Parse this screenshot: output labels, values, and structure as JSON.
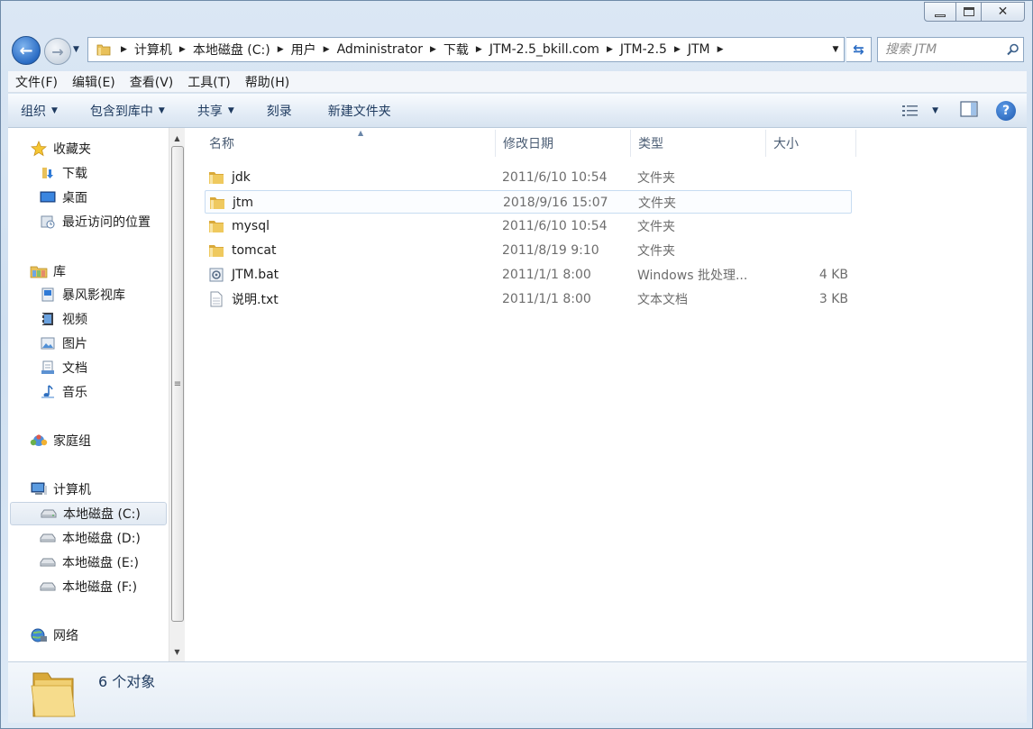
{
  "window": {
    "title": "JTM"
  },
  "caption_buttons": {
    "close_glyph": "✕"
  },
  "nav": {
    "back_glyph": "←",
    "forward_glyph": "→",
    "refresh_glyph": "⇆"
  },
  "breadcrumb": [
    "计算机",
    "本地磁盘 (C:)",
    "用户",
    "Administrator",
    "下载",
    "JTM-2.5_bkill.com",
    "JTM-2.5",
    "JTM"
  ],
  "search": {
    "placeholder": "搜索 JTM"
  },
  "menubar": {
    "file": "文件(F)",
    "edit": "编辑(E)",
    "view": "查看(V)",
    "tools": "工具(T)",
    "help": "帮助(H)"
  },
  "toolbar": {
    "organize": "组织",
    "include_library": "包含到库中",
    "share": "共享",
    "burn": "刻录",
    "new_folder": "新建文件夹",
    "help_glyph": "?"
  },
  "sidebar": {
    "favorites": {
      "label": "收藏夹",
      "items": [
        "下载",
        "桌面",
        "最近访问的位置"
      ]
    },
    "libraries": {
      "label": "库",
      "items": [
        "暴风影视库",
        "视频",
        "图片",
        "文档",
        "音乐"
      ]
    },
    "homegroup": {
      "label": "家庭组"
    },
    "computer": {
      "label": "计算机",
      "items": [
        "本地磁盘 (C:)",
        "本地磁盘 (D:)",
        "本地磁盘 (E:)",
        "本地磁盘 (F:)"
      ]
    },
    "network": {
      "label": "网络"
    }
  },
  "columns": {
    "name": "名称",
    "modified": "修改日期",
    "type": "类型",
    "size": "大小"
  },
  "files": [
    {
      "name": "jdk",
      "modified": "2011/6/10 10:54",
      "type": "文件夹",
      "size": ""
    },
    {
      "name": "jtm",
      "modified": "2018/9/16 15:07",
      "type": "文件夹",
      "size": ""
    },
    {
      "name": "mysql",
      "modified": "2011/6/10 10:54",
      "type": "文件夹",
      "size": ""
    },
    {
      "name": "tomcat",
      "modified": "2011/8/19 9:10",
      "type": "文件夹",
      "size": ""
    },
    {
      "name": "JTM.bat",
      "modified": "2011/1/1 8:00",
      "type": "Windows 批处理...",
      "size": "4 KB"
    },
    {
      "name": "说明.txt",
      "modified": "2011/1/1 8:00",
      "type": "文本文档",
      "size": "3 KB"
    }
  ],
  "status": {
    "count_text": "6 个对象"
  },
  "colors": {
    "accent": "#2a6cc4",
    "folder": "#e9c15a",
    "selection_border": "#c7dcf1"
  }
}
